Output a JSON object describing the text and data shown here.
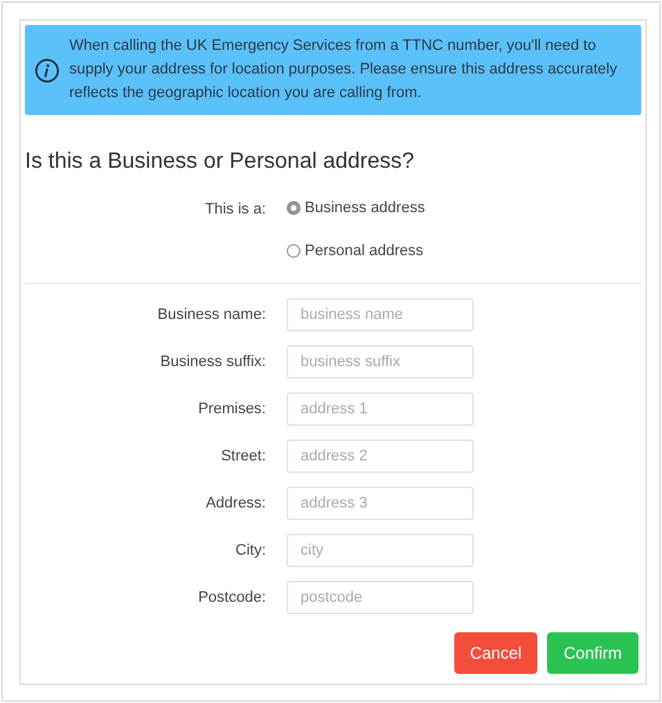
{
  "alert": {
    "text": "When calling the UK Emergency Services from a TTNC number, you'll need to supply your address for location purposes. Please ensure this address accurately reflects the geographic location you are calling from."
  },
  "heading": "Is this a Business or Personal address?",
  "address_type": {
    "label": "This is a:",
    "options": [
      {
        "label": "Business address",
        "selected": true
      },
      {
        "label": "Personal address",
        "selected": false
      }
    ]
  },
  "fields": [
    {
      "label": "Business name:",
      "placeholder": "business name"
    },
    {
      "label": "Business suffix:",
      "placeholder": "business suffix"
    },
    {
      "label": "Premises:",
      "placeholder": "address 1"
    },
    {
      "label": "Street:",
      "placeholder": "address 2"
    },
    {
      "label": "Address:",
      "placeholder": "address 3"
    },
    {
      "label": "City:",
      "placeholder": "city"
    },
    {
      "label": "Postcode:",
      "placeholder": "postcode"
    }
  ],
  "buttons": [
    {
      "label": "Cancel",
      "kind": "danger"
    },
    {
      "label": "Confirm",
      "kind": "success"
    }
  ]
}
